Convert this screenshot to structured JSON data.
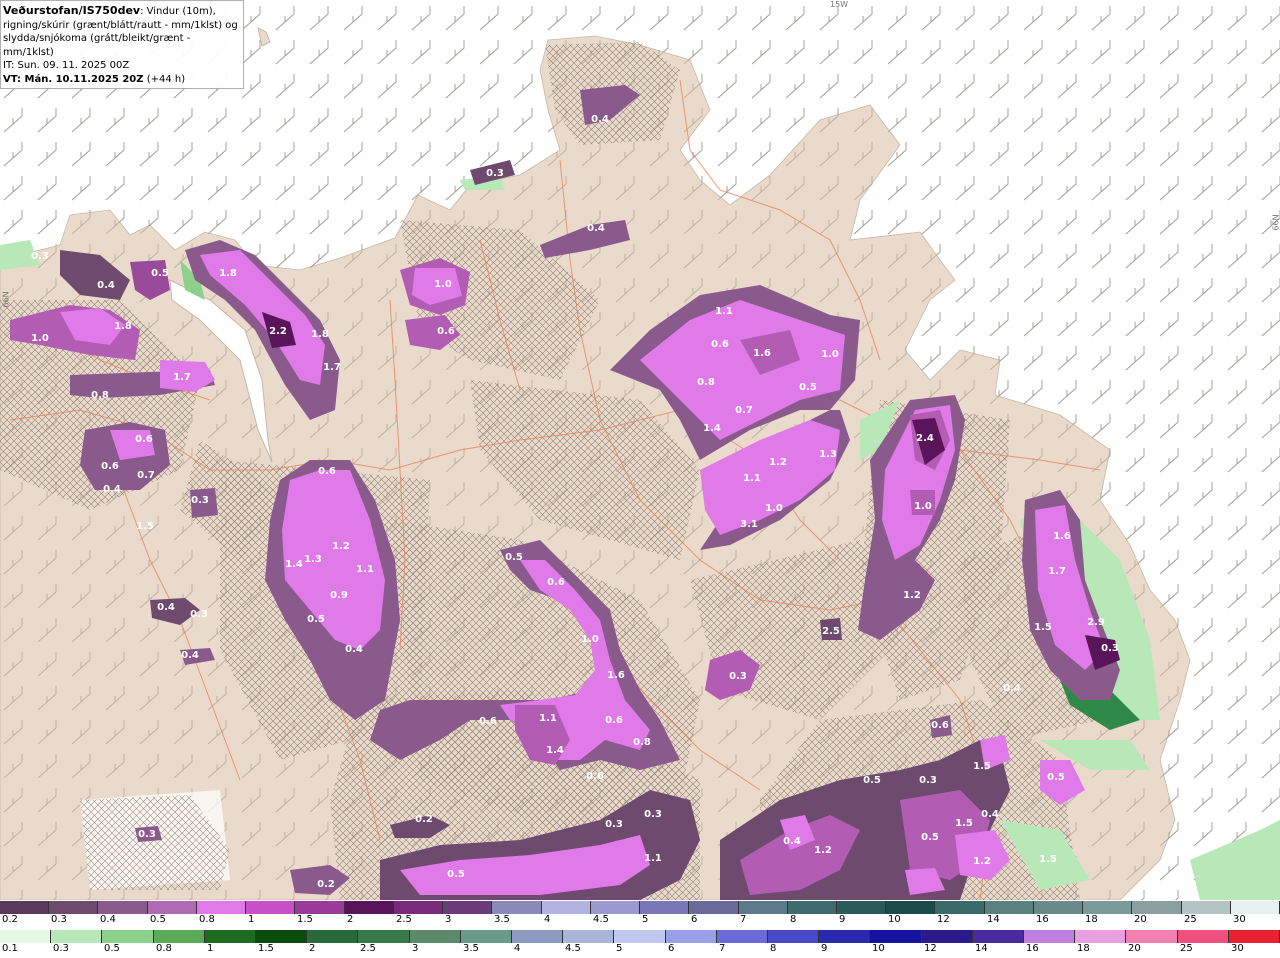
{
  "header": {
    "brand": "Veðurstofan/IS750dev",
    "description": ": Vindur (10m), rigning/skúrir (grænt/blátt/rautt - mm/1klst) og slydda/snjókoma (grátt/bleikt/grænt - mm/1klst)",
    "issue_time": "IT: Sun. 09. 11. 2025 00Z",
    "valid_time_bold": "VT: Mán. 10.11.2025 20Z",
    "valid_time_rest": " (+44 h)"
  },
  "grid_labels": {
    "top": "15W",
    "right": "66N",
    "left": "66N"
  },
  "colors": {
    "land": "#eadacb",
    "sea": "#ffffff",
    "roads": "#e8835a",
    "hatch": "#8a7a6e",
    "snow_light": "#6e4a6e",
    "snow_mid": "#b25cb4",
    "snow_heavy": "#e07ae8",
    "snow_peak": "#3d1240",
    "rain_light": "#b8e8b8",
    "rain_mid": "#2f8a4a"
  },
  "value_labels": [
    "0.4",
    "0.3",
    "0.4",
    "0.3",
    "0.4",
    "0.5",
    "1.8",
    "1.0",
    "1.8",
    "2.2",
    "1.8",
    "1.7",
    "1.0",
    "0.6",
    "1.7",
    "0.8",
    "0.6",
    "0.6",
    "0.7",
    "0.4",
    "0.3",
    "1.5",
    "1.1",
    "0.6",
    "1.6",
    "1.0",
    "0.8",
    "0.5",
    "0.7",
    "1.4",
    "1.2",
    "1.3",
    "1.1",
    "1.0",
    "3.1",
    "2.4",
    "1.0",
    "1.2",
    "0.6",
    "1.4",
    "1.3",
    "1.2",
    "1.1",
    "0.9",
    "0.5",
    "0.4",
    "0.3",
    "0.4",
    "0.4",
    "0.5",
    "0.6",
    "1.0",
    "1.6",
    "0.6",
    "1.1",
    "0.8",
    "1.4",
    "0.6",
    "0.6",
    "0.3",
    "0.3",
    "0.3",
    "0.2",
    "0.3",
    "1.1",
    "0.5",
    "0.2",
    "2.5",
    "1.6",
    "1.7",
    "1.5",
    "2.9",
    "0.3",
    "0.4",
    "0.6",
    "1.5",
    "0.5",
    "0.3",
    "0.5",
    "0.4",
    "1.5",
    "0.4",
    "1.2",
    "0.5",
    "1.2",
    "1.5"
  ],
  "snow_scale": {
    "labels": [
      "0.2",
      "0.3",
      "0.4",
      "0.5",
      "0.8",
      "1",
      "1.5",
      "2",
      "2.5",
      "3",
      "3.5",
      "4",
      "4.5",
      "5",
      "6",
      "7",
      "8",
      "9",
      "10",
      "12",
      "14",
      "16",
      "18",
      "20",
      "25",
      "30"
    ],
    "colors": [
      "#5a3a5a",
      "#6e4a6e",
      "#8a5a8c",
      "#b06ab4",
      "#e07ae8",
      "#c850c8",
      "#9a3a9a",
      "#5a145a",
      "#7a2a7a",
      "#6a3a7a",
      "#8a8ab8",
      "#b4b4e4",
      "#9a9ad0",
      "#7878b8",
      "#6a6a9a",
      "#5a7a8a",
      "#3e6a70",
      "#2a5a5a",
      "#1a4a4a",
      "#3a6a6a",
      "#5a8080",
      "#6a8a8a",
      "#7a9a9a",
      "#8aa0a0",
      "#b4c4c4",
      "#e8f0f0"
    ]
  },
  "rain_scale": {
    "labels": [
      "0.1",
      "0.3",
      "0.5",
      "0.8",
      "1",
      "1.5",
      "2",
      "2.5",
      "3",
      "3.5",
      "4",
      "4.5",
      "5",
      "6",
      "7",
      "8",
      "9",
      "10",
      "12",
      "14",
      "16",
      "18",
      "20",
      "25",
      "30"
    ],
    "colors": [
      "#e4f8e4",
      "#b8e8b8",
      "#8cd08c",
      "#5aaa5a",
      "#1e6a1e",
      "#0a4a0a",
      "#2a6a3a",
      "#3a7a4a",
      "#5a8a6a",
      "#6a9a8a",
      "#8a9ac0",
      "#a8b4d8",
      "#c0c8f0",
      "#9aa0e8",
      "#6a6ad8",
      "#4a4ac8",
      "#2a2ab0",
      "#1414a0",
      "#2a1a8a",
      "#4a2aa0",
      "#c080e0",
      "#e8a0e0",
      "#f080b0",
      "#f05080",
      "#e82030"
    ]
  }
}
